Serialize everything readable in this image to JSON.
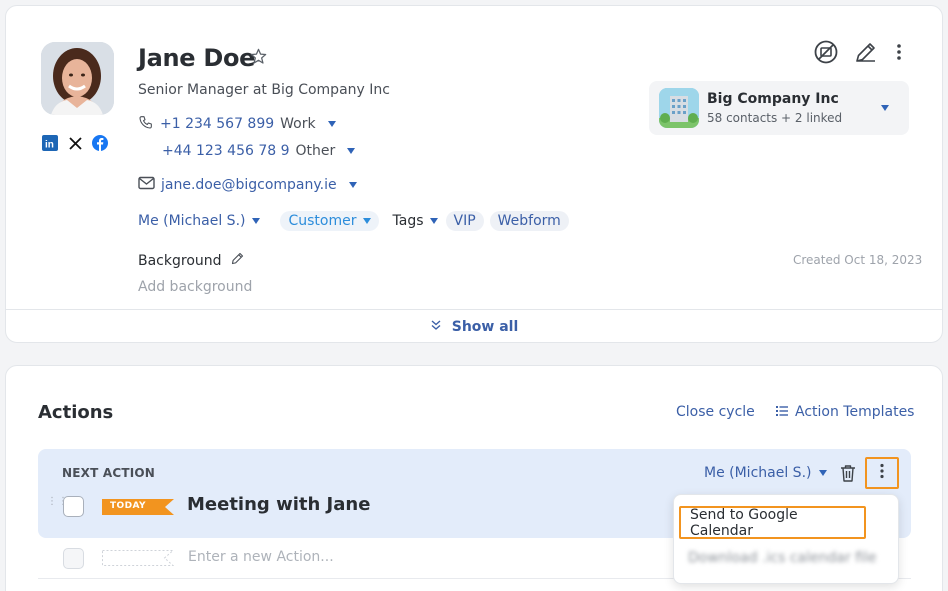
{
  "contact": {
    "name": "Jane Doe",
    "title": "Senior Manager at Big Company Inc",
    "phones": [
      {
        "number": "+1 234 567 899",
        "type": "Work"
      },
      {
        "number": "+44 123 456 78 9",
        "type": "Other"
      }
    ],
    "email": "jane.doe@bigcompany.ie",
    "owner": "Me (Michael S.)",
    "status": "Customer",
    "tags_label": "Tags",
    "tags": [
      "VIP",
      "Webform"
    ],
    "background_label": "Background",
    "background_placeholder": "Add background",
    "created": "Created Oct 18, 2023",
    "show_all": "Show all",
    "social": [
      "linkedin-icon",
      "x-icon",
      "facebook-icon"
    ]
  },
  "company": {
    "name": "Big Company Inc",
    "summary": "58 contacts + 2 linked"
  },
  "actions": {
    "title": "Actions",
    "close_cycle": "Close cycle",
    "templates": "Action Templates",
    "next_label": "NEXT ACTION",
    "badge": "TODAY",
    "next_title": "Meeting with Jane",
    "owner": "Me (Michael S.)",
    "new_placeholder": "Enter a new Action..."
  },
  "menu": {
    "send_google": "Send to Google Calendar",
    "download_ics": "Download .ics calendar file"
  },
  "colors": {
    "accent": "#3b5fa7",
    "highlight": "#f2941f",
    "next_bg": "#e3ecfa",
    "today_badge": "#f2941f"
  }
}
